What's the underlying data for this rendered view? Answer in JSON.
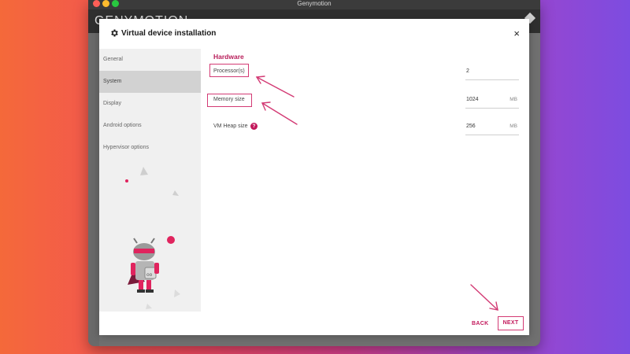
{
  "window": {
    "title": "Genymotion"
  },
  "app": {
    "logo_text": "GENYMOTION"
  },
  "dialog": {
    "title": "Virtual device installation",
    "close_symbol": "×",
    "nav": [
      "General",
      "System",
      "Display",
      "Android options",
      "Hypervisor options"
    ],
    "active_nav_index": 1,
    "section_title": "Hardware",
    "fields": [
      {
        "label": "Processor(s)",
        "value": "2",
        "unit": ""
      },
      {
        "label": "Memory size",
        "value": "1024",
        "unit": "MB"
      },
      {
        "label": "VM Heap size",
        "value": "256",
        "unit": "MB",
        "help": "?"
      }
    ],
    "back_label": "BACK",
    "next_label": "NEXT"
  },
  "icons": [
    "gear-icon",
    "close-icon",
    "help-icon",
    "android-robot-mascot"
  ],
  "colors": {
    "accent": "#c2185b",
    "annotation": "#d33a74",
    "sidebar_active": "#d2d2d2"
  }
}
